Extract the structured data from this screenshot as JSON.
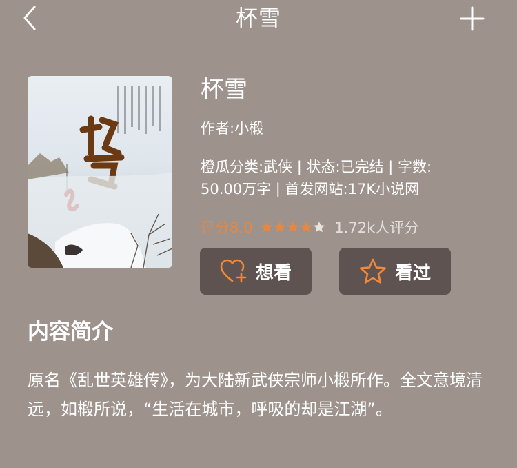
{
  "nav": {
    "title": "杯雪",
    "back_icon": "chevron-left-icon",
    "add_icon": "plus-icon"
  },
  "book": {
    "title": "杯雪",
    "author": "作者:小椴",
    "meta_line1": "橙瓜分类:武侠 | 状态:已完结 | 字数:",
    "meta_line2": "50.00万字 | 首发网站:17K小说网",
    "rating_label": "评分8.0",
    "stars_filled": 4,
    "stars_total": 5,
    "rating_count": "1.72k人评分"
  },
  "actions": {
    "want_label": "想看",
    "want_icon": "heart-plus-icon",
    "seen_label": "看过",
    "seen_icon": "star-outline-icon"
  },
  "synopsis": {
    "heading": "内容简介",
    "text": "原名《乱世英雄传》，为大陆新武侠宗师小椴所作。全文意境清远，如椴所说，“生活在城市，呼吸的却是江湖”。"
  },
  "colors": {
    "background": "#9e928c",
    "button": "#5e5350",
    "accent": "#e8873f",
    "text": "#ffffff"
  }
}
